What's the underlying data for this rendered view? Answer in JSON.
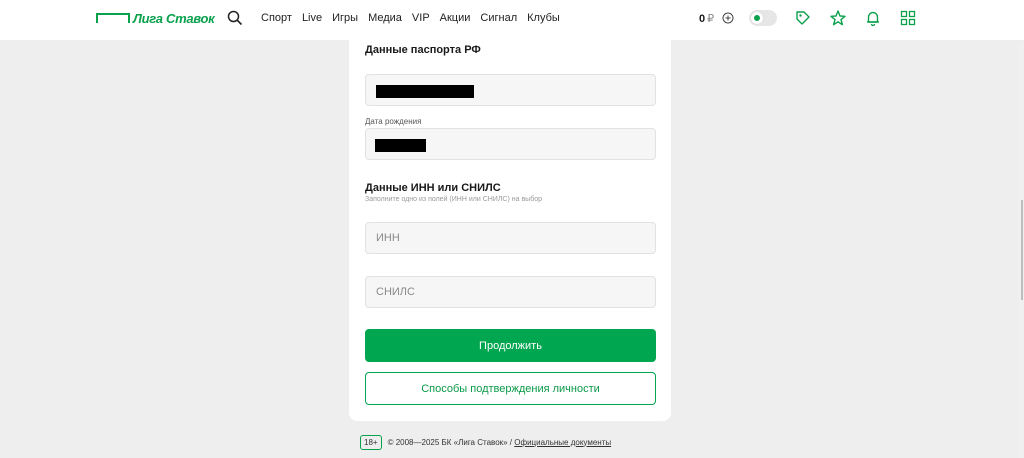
{
  "header": {
    "logo_text": "Лига Ставок",
    "nav": [
      "Спорт",
      "Live",
      "Игры",
      "Медиа",
      "VIP",
      "Акции",
      "Сигнал",
      "Клубы"
    ],
    "balance_amount": "0",
    "balance_currency": "₽",
    "icons": [
      "search-icon",
      "plus-circle-icon",
      "toggle-switch",
      "coupon-icon",
      "star-icon",
      "bell-icon",
      "grid-icon"
    ],
    "accent_color": "#0aa14d"
  },
  "form": {
    "passport_heading": "Данные паспорта РФ",
    "dob_label": "Дата рождения",
    "inn_heading": "Данные ИНН или СНИЛС",
    "inn_subtitle": "Заполните одно из полей (ИНН или СНИЛС) на выбор",
    "inn_placeholder": "ИНН",
    "snils_placeholder": "СНИЛС",
    "continue_label": "Продолжить",
    "verify_methods_label": "Способы подтверждения личности"
  },
  "footer": {
    "age_badge": "18+",
    "copyright": "© 2008—2025 БК «Лига Ставок» /",
    "docs_link": "Официальные документы"
  }
}
